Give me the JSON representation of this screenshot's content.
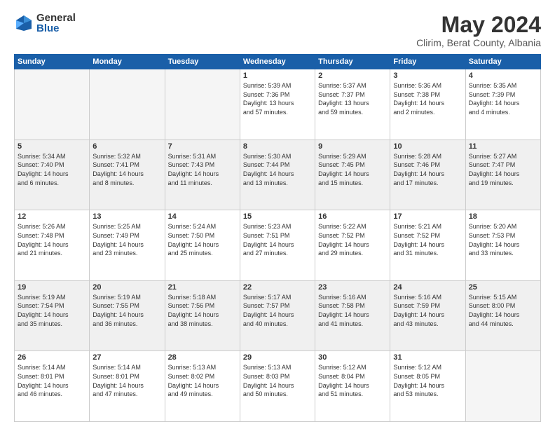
{
  "logo": {
    "general": "General",
    "blue": "Blue"
  },
  "title": {
    "month_year": "May 2024",
    "location": "Clirim, Berat County, Albania"
  },
  "days_of_week": [
    "Sunday",
    "Monday",
    "Tuesday",
    "Wednesday",
    "Thursday",
    "Friday",
    "Saturday"
  ],
  "weeks": [
    {
      "shaded": false,
      "days": [
        {
          "num": "",
          "info": ""
        },
        {
          "num": "",
          "info": ""
        },
        {
          "num": "",
          "info": ""
        },
        {
          "num": "1",
          "info": "Sunrise: 5:39 AM\nSunset: 7:36 PM\nDaylight: 13 hours\nand 57 minutes."
        },
        {
          "num": "2",
          "info": "Sunrise: 5:37 AM\nSunset: 7:37 PM\nDaylight: 13 hours\nand 59 minutes."
        },
        {
          "num": "3",
          "info": "Sunrise: 5:36 AM\nSunset: 7:38 PM\nDaylight: 14 hours\nand 2 minutes."
        },
        {
          "num": "4",
          "info": "Sunrise: 5:35 AM\nSunset: 7:39 PM\nDaylight: 14 hours\nand 4 minutes."
        }
      ]
    },
    {
      "shaded": true,
      "days": [
        {
          "num": "5",
          "info": "Sunrise: 5:34 AM\nSunset: 7:40 PM\nDaylight: 14 hours\nand 6 minutes."
        },
        {
          "num": "6",
          "info": "Sunrise: 5:32 AM\nSunset: 7:41 PM\nDaylight: 14 hours\nand 8 minutes."
        },
        {
          "num": "7",
          "info": "Sunrise: 5:31 AM\nSunset: 7:43 PM\nDaylight: 14 hours\nand 11 minutes."
        },
        {
          "num": "8",
          "info": "Sunrise: 5:30 AM\nSunset: 7:44 PM\nDaylight: 14 hours\nand 13 minutes."
        },
        {
          "num": "9",
          "info": "Sunrise: 5:29 AM\nSunset: 7:45 PM\nDaylight: 14 hours\nand 15 minutes."
        },
        {
          "num": "10",
          "info": "Sunrise: 5:28 AM\nSunset: 7:46 PM\nDaylight: 14 hours\nand 17 minutes."
        },
        {
          "num": "11",
          "info": "Sunrise: 5:27 AM\nSunset: 7:47 PM\nDaylight: 14 hours\nand 19 minutes."
        }
      ]
    },
    {
      "shaded": false,
      "days": [
        {
          "num": "12",
          "info": "Sunrise: 5:26 AM\nSunset: 7:48 PM\nDaylight: 14 hours\nand 21 minutes."
        },
        {
          "num": "13",
          "info": "Sunrise: 5:25 AM\nSunset: 7:49 PM\nDaylight: 14 hours\nand 23 minutes."
        },
        {
          "num": "14",
          "info": "Sunrise: 5:24 AM\nSunset: 7:50 PM\nDaylight: 14 hours\nand 25 minutes."
        },
        {
          "num": "15",
          "info": "Sunrise: 5:23 AM\nSunset: 7:51 PM\nDaylight: 14 hours\nand 27 minutes."
        },
        {
          "num": "16",
          "info": "Sunrise: 5:22 AM\nSunset: 7:52 PM\nDaylight: 14 hours\nand 29 minutes."
        },
        {
          "num": "17",
          "info": "Sunrise: 5:21 AM\nSunset: 7:52 PM\nDaylight: 14 hours\nand 31 minutes."
        },
        {
          "num": "18",
          "info": "Sunrise: 5:20 AM\nSunset: 7:53 PM\nDaylight: 14 hours\nand 33 minutes."
        }
      ]
    },
    {
      "shaded": true,
      "days": [
        {
          "num": "19",
          "info": "Sunrise: 5:19 AM\nSunset: 7:54 PM\nDaylight: 14 hours\nand 35 minutes."
        },
        {
          "num": "20",
          "info": "Sunrise: 5:19 AM\nSunset: 7:55 PM\nDaylight: 14 hours\nand 36 minutes."
        },
        {
          "num": "21",
          "info": "Sunrise: 5:18 AM\nSunset: 7:56 PM\nDaylight: 14 hours\nand 38 minutes."
        },
        {
          "num": "22",
          "info": "Sunrise: 5:17 AM\nSunset: 7:57 PM\nDaylight: 14 hours\nand 40 minutes."
        },
        {
          "num": "23",
          "info": "Sunrise: 5:16 AM\nSunset: 7:58 PM\nDaylight: 14 hours\nand 41 minutes."
        },
        {
          "num": "24",
          "info": "Sunrise: 5:16 AM\nSunset: 7:59 PM\nDaylight: 14 hours\nand 43 minutes."
        },
        {
          "num": "25",
          "info": "Sunrise: 5:15 AM\nSunset: 8:00 PM\nDaylight: 14 hours\nand 44 minutes."
        }
      ]
    },
    {
      "shaded": false,
      "days": [
        {
          "num": "26",
          "info": "Sunrise: 5:14 AM\nSunset: 8:01 PM\nDaylight: 14 hours\nand 46 minutes."
        },
        {
          "num": "27",
          "info": "Sunrise: 5:14 AM\nSunset: 8:01 PM\nDaylight: 14 hours\nand 47 minutes."
        },
        {
          "num": "28",
          "info": "Sunrise: 5:13 AM\nSunset: 8:02 PM\nDaylight: 14 hours\nand 49 minutes."
        },
        {
          "num": "29",
          "info": "Sunrise: 5:13 AM\nSunset: 8:03 PM\nDaylight: 14 hours\nand 50 minutes."
        },
        {
          "num": "30",
          "info": "Sunrise: 5:12 AM\nSunset: 8:04 PM\nDaylight: 14 hours\nand 51 minutes."
        },
        {
          "num": "31",
          "info": "Sunrise: 5:12 AM\nSunset: 8:05 PM\nDaylight: 14 hours\nand 53 minutes."
        },
        {
          "num": "",
          "info": ""
        }
      ]
    }
  ]
}
